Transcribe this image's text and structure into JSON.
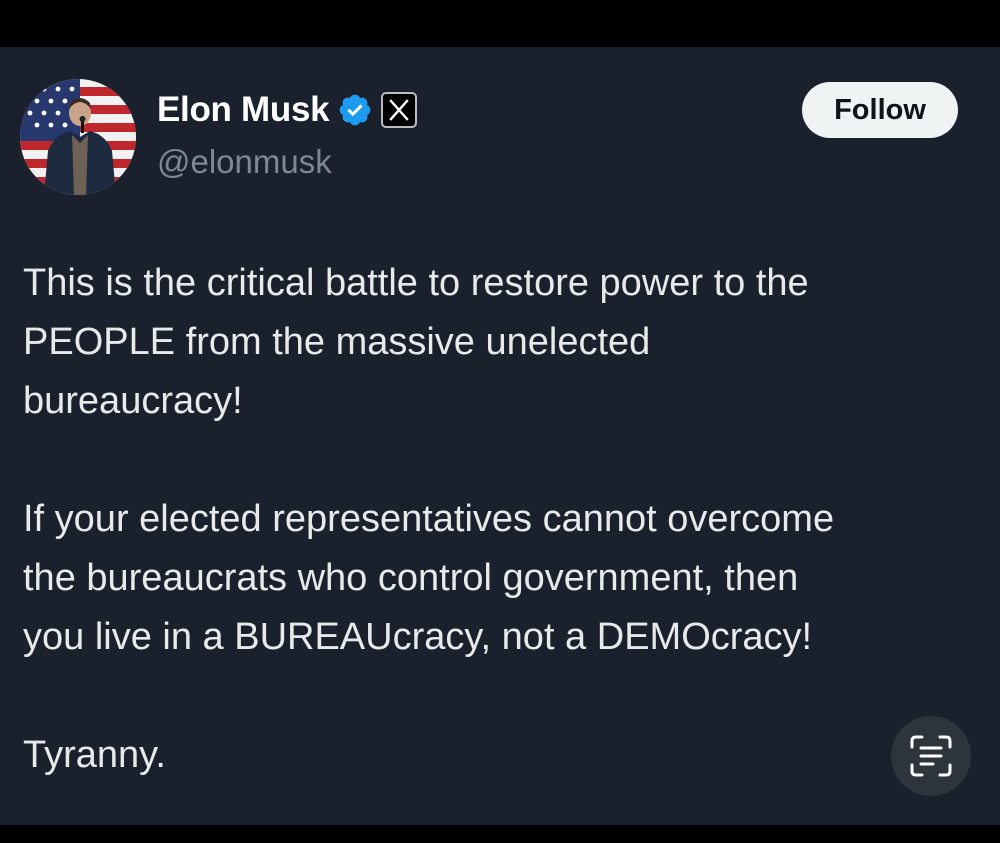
{
  "author": {
    "display_name": "Elon Musk",
    "handle": "@elonmusk",
    "verified_icon": "verified-badge-icon",
    "affiliation_icon": "x-logo-icon",
    "verified_color": "#1d9bf0"
  },
  "header": {
    "follow_label": "Follow"
  },
  "tweet": {
    "paragraphs": [
      [
        "This is the critical battle to restore power to the",
        "PEOPLE from the massive unelected",
        "bureaucracy!"
      ],
      [
        "If your elected representatives cannot overcome",
        "the bureaucrats who control government, then",
        "you live in a BUREAUcracy, not a DEMOcracy!"
      ],
      [
        "Tyranny."
      ]
    ]
  },
  "overlay": {
    "scan_icon": "live-text-scan-icon"
  },
  "colors": {
    "card_background": "#1a212c",
    "text_primary": "#e7e9ea",
    "text_secondary": "#7c8896",
    "follow_button_bg": "#eff3f4"
  }
}
